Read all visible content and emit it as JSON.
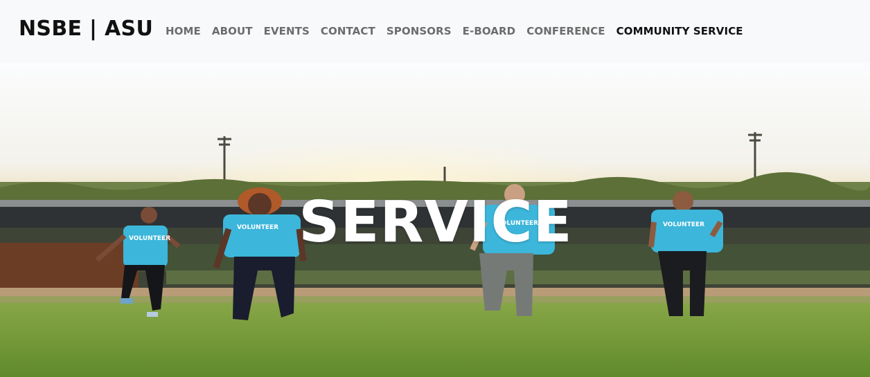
{
  "brand": "NSBE | ASU",
  "nav": {
    "items": [
      {
        "label": "HOME"
      },
      {
        "label": "ABOUT"
      },
      {
        "label": "EVENTS"
      },
      {
        "label": "CONTACT"
      },
      {
        "label": "SPONSORS"
      },
      {
        "label": "E-BOARD"
      },
      {
        "label": "CONFERENCE"
      },
      {
        "label": "COMMUNITY SERVICE",
        "active": true
      }
    ]
  },
  "hero": {
    "title": "SERVICE",
    "shirt_text": "VOLUNTEER"
  },
  "colors": {
    "navbar_bg": "#f8f9fa",
    "nav_text": "#6c6c6c",
    "nav_active": "#111111",
    "shirt": "#3cb6da",
    "grass": "#7a9a3a"
  }
}
